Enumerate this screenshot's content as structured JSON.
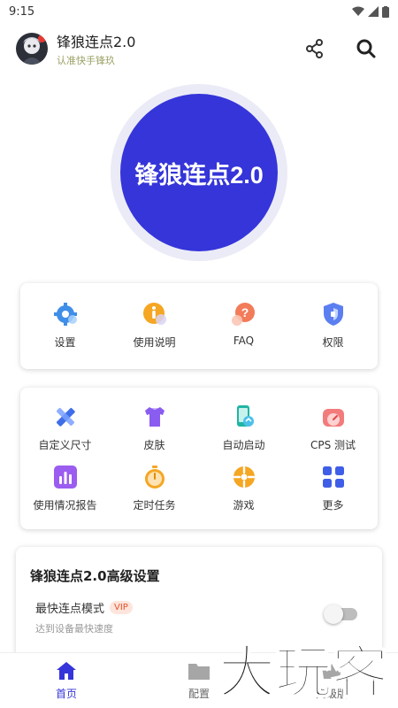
{
  "status": {
    "time": "9:15"
  },
  "header": {
    "title": "锋狼连点2.0",
    "subtitle": "认准快手锋玖"
  },
  "hero": {
    "label": "锋狼连点2.0"
  },
  "card1": {
    "items": [
      {
        "label": "设置",
        "icon": "gear-icon"
      },
      {
        "label": "使用说明",
        "icon": "info-icon"
      },
      {
        "label": "FAQ",
        "icon": "question-icon"
      },
      {
        "label": "权限",
        "icon": "shield-icon"
      }
    ]
  },
  "card2": {
    "items": [
      {
        "label": "自定义尺寸",
        "icon": "ruler-pencil-icon"
      },
      {
        "label": "皮肤",
        "icon": "shirt-icon"
      },
      {
        "label": "自动启动",
        "icon": "phone-auto-icon"
      },
      {
        "label": "CPS 测试",
        "icon": "speedometer-icon"
      },
      {
        "label": "使用情况报告",
        "icon": "bar-chart-icon"
      },
      {
        "label": "定时任务",
        "icon": "stopwatch-icon"
      },
      {
        "label": "游戏",
        "icon": "wheel-icon"
      },
      {
        "label": "更多",
        "icon": "grid-icon"
      }
    ]
  },
  "card3": {
    "title": "锋狼连点2.0高级设置",
    "row_label": "最快连点模式",
    "vip_badge": "VIP",
    "row_desc": "达到设备最快速度",
    "toggle_on": false
  },
  "nav": {
    "items": [
      {
        "label": "首页",
        "icon": "home-icon",
        "active": true
      },
      {
        "label": "配置",
        "icon": "folder-icon",
        "active": false
      },
      {
        "label": "高级版",
        "icon": "crown-icon",
        "active": false
      }
    ]
  },
  "watermark": {
    "text": "大玩客"
  },
  "colors": {
    "accent": "#3535d9",
    "vip_text": "#e4532b",
    "subtitle": "#9aa064"
  }
}
